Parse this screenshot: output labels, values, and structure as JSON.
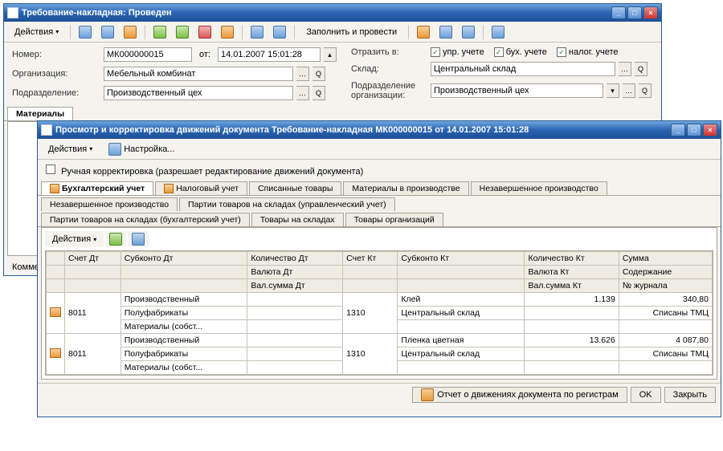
{
  "win1": {
    "title": "Требование-накладная: Проведен",
    "toolbar": {
      "actions": "Действия",
      "fillpost": "Заполнить и провести"
    },
    "form": {
      "number_label": "Номер:",
      "number": "МК000000015",
      "date_prefix": "от:",
      "date": "14.01.2007 15:01:28",
      "org_label": "Организация:",
      "org": "Мебельный комбинат",
      "dept_label": "Подразделение:",
      "dept": "Производственный цех",
      "reflect_label": "Отразить в:",
      "chk1": "упр. учете",
      "chk2": "бух. учете",
      "chk3": "налог. учете",
      "warehouse_label": "Склад:",
      "warehouse": "Центральный склад",
      "dept_org_label": "Подразделение организации:",
      "dept_org": "Производственный цех"
    },
    "bottom_tab": "Материалы",
    "comment_label": "Комментарий:"
  },
  "win2": {
    "title": "Просмотр и корректировка движений документа Требование-накладная МК000000015 от 14.01.2007 15:01:28",
    "toolbar": {
      "actions": "Действия",
      "settings": "Настройка..."
    },
    "manual_checkbox": "Ручная корректировка (разрешает редактирование движений документа)",
    "tabs_row1": [
      "Бухгалтерский учет",
      "Налоговый учет",
      "Списанные товары",
      "Материалы в производстве",
      "Незавершенное производство"
    ],
    "tabs_row2": [
      "Незавершенное производство",
      "Партии товаров на складах (управленческий учет)"
    ],
    "tabs_row3": [
      "Партии товаров на складах (бухгалтерский учет)",
      "Товары на складах",
      "Товары организаций"
    ],
    "actions2": "Действия",
    "grid": {
      "headers": {
        "acc_dt": "Счет Дт",
        "sub_dt": "Субконто Дт",
        "qty_dt": "Количество Дт",
        "acc_kt": "Счет Кт",
        "sub_kt": "Субконто Кт",
        "qty_kt": "Количество Кт",
        "sum": "Сумма",
        "empty": "",
        "val_dt": "Валюта Дт",
        "valsum_dt": "Вал.сумма Дт",
        "val_kt": "Валюта Кт",
        "valsum_kt": "Вал.сумма Кт",
        "content": "Содержание",
        "journal": "№ журнала"
      },
      "rows": [
        {
          "acc_dt": "8011",
          "sub_dt": [
            "Производственный",
            "Полуфабрикаты",
            "Материалы (собст..."
          ],
          "acc_kt": "1310",
          "sub_kt": [
            "Клей",
            "Центральный склад"
          ],
          "qty_kt": "1.139",
          "sum": "340,80",
          "content": "Списаны ТМЦ"
        },
        {
          "acc_dt": "8011",
          "sub_dt": [
            "Производственный",
            "Полуфабрикаты",
            "Материалы (собст..."
          ],
          "acc_kt": "1310",
          "sub_kt": [
            "Пленка цветная",
            "Центральный склад"
          ],
          "qty_kt": "13.626",
          "sum": "4 087,80",
          "content": "Списаны ТМЦ"
        }
      ]
    },
    "footer": {
      "report": "Отчет о движениях документа по регистрам",
      "ok": "OK",
      "close": "Закрыть"
    }
  }
}
